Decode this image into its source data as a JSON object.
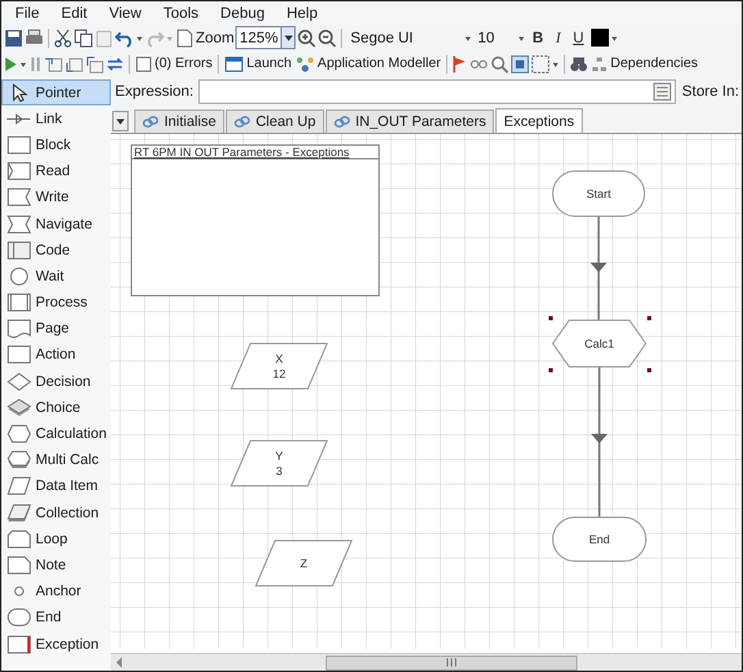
{
  "menu": [
    "File",
    "Edit",
    "View",
    "Tools",
    "Debug",
    "Help"
  ],
  "toolbar": {
    "zoom_label": "Zoom",
    "zoom_value": "125%",
    "font": "Segoe UI",
    "font_size": "10",
    "bold": "B",
    "italic": "I",
    "underline": "U"
  },
  "debug_toolbar": {
    "errors": "(0) Errors",
    "launch": "Launch",
    "modeller": "Application Modeller",
    "dependencies": "Dependencies"
  },
  "palette": [
    {
      "kind": "pointer",
      "label": "Pointer",
      "selected": true
    },
    {
      "kind": "link",
      "label": "Link",
      "selected": false
    },
    {
      "kind": "block",
      "label": "Block",
      "selected": false
    },
    {
      "kind": "read",
      "label": "Read",
      "selected": false
    },
    {
      "kind": "write",
      "label": "Write",
      "selected": false
    },
    {
      "kind": "navigate",
      "label": "Navigate",
      "selected": false
    },
    {
      "kind": "code",
      "label": "Code",
      "selected": false
    },
    {
      "kind": "wait",
      "label": "Wait",
      "selected": false
    },
    {
      "kind": "process",
      "label": "Process",
      "selected": false
    },
    {
      "kind": "page",
      "label": "Page",
      "selected": false
    },
    {
      "kind": "action",
      "label": "Action",
      "selected": false
    },
    {
      "kind": "decision",
      "label": "Decision",
      "selected": false
    },
    {
      "kind": "choice",
      "label": "Choice",
      "selected": false
    },
    {
      "kind": "calculation",
      "label": "Calculation",
      "selected": false
    },
    {
      "kind": "multi-calc",
      "label": "Multi Calc",
      "selected": false
    },
    {
      "kind": "data-item",
      "label": "Data Item",
      "selected": false
    },
    {
      "kind": "collection",
      "label": "Collection",
      "selected": false
    },
    {
      "kind": "loop",
      "label": "Loop",
      "selected": false
    },
    {
      "kind": "note",
      "label": "Note",
      "selected": false
    },
    {
      "kind": "anchor",
      "label": "Anchor",
      "selected": false
    },
    {
      "kind": "end",
      "label": "End",
      "selected": false
    },
    {
      "kind": "exception",
      "label": "Exception",
      "selected": false
    }
  ],
  "expression": {
    "label": "Expression:",
    "store_label": "Store In:"
  },
  "tabs": [
    {
      "label": "Initialise",
      "selected": false
    },
    {
      "label": "Clean Up",
      "selected": false
    },
    {
      "label": "IN_OUT Parameters",
      "selected": false
    },
    {
      "label": "Exceptions",
      "selected": true
    }
  ],
  "diagram": [
    {
      "kind": "note",
      "title": "RT 6PM IN OUT Parameters - Exceptions"
    },
    {
      "kind": "start",
      "lines": [
        "Start"
      ],
      "selected": false
    },
    {
      "kind": "calculation",
      "lines": [
        "Calc1"
      ],
      "selected": true
    },
    {
      "kind": "end",
      "lines": [
        "End"
      ],
      "selected": false
    },
    {
      "kind": "data",
      "lines": [
        "X",
        "12"
      ],
      "selected": false
    },
    {
      "kind": "data",
      "lines": [
        "Y",
        "3"
      ],
      "selected": false
    },
    {
      "kind": "data",
      "lines": [
        "Z"
      ],
      "selected": false
    }
  ]
}
